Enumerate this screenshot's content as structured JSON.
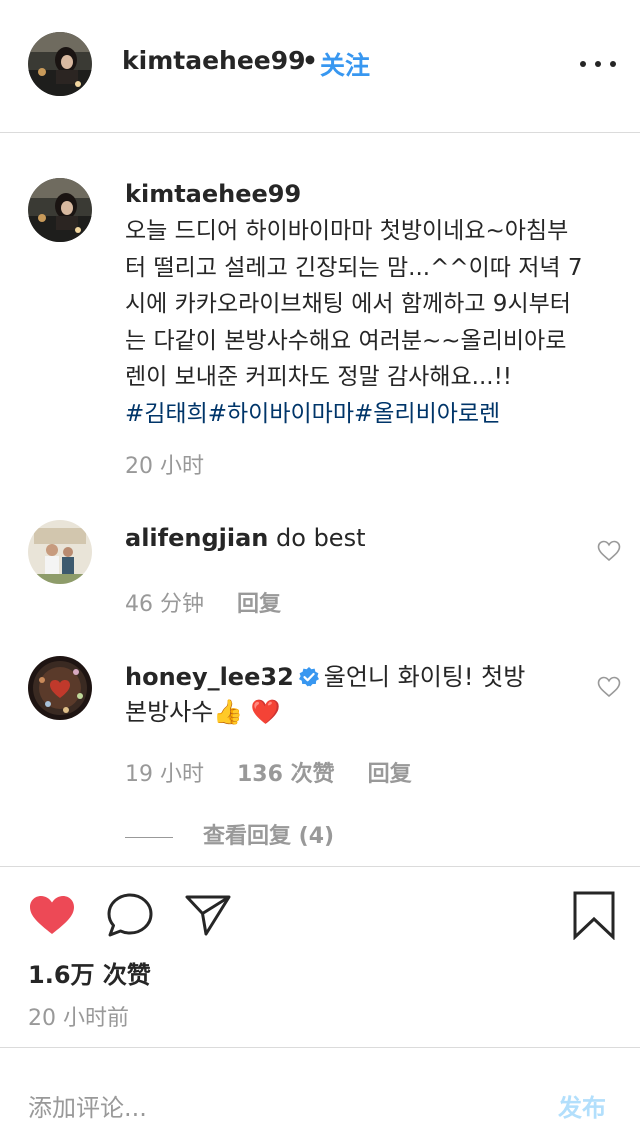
{
  "header": {
    "username": "kimtaehee99",
    "separator": "•",
    "follow_label": "关注"
  },
  "caption": {
    "username": "kimtaehee99",
    "lines": [
      "오늘 드디어 하이바이마마 첫방이네요~아침부",
      "터 떨리고 설레고 긴장되는 맘...^^이따 저녁 7",
      "시에 카카오라이브채팅 에서 함께하고 9시부터",
      "는 다같이 본방사수해요 여러분~~올리비아로",
      "렌이 보내준 커피차도 정말 감사해요...!!"
    ],
    "hashtags": "#김태희#하이바이마마#올리비아로렌",
    "time": "20 小时"
  },
  "comments": [
    {
      "username": "alifengjian",
      "text": "do best",
      "time": "46 分钟",
      "reply_label": "回复"
    },
    {
      "username": "honey_lee32",
      "text_line1": "울언니 화이팅! 첫방",
      "text_line2": "본방사수👍 ❤️",
      "time": "19 小时",
      "likes": "136 次赞",
      "reply_label": "回复",
      "view_replies": "查看回复 (4)"
    }
  ],
  "post": {
    "likes": "1.6万 次赞",
    "time": "20 小时前"
  },
  "composer": {
    "placeholder": "添加评论...",
    "publish_label": "发布"
  },
  "icons": {
    "like": "heart-filled-icon",
    "comment": "comment-bubble-icon",
    "share": "paper-plane-icon",
    "save": "bookmark-icon",
    "more": "more-dots-icon",
    "comment_like": "heart-outline-icon",
    "verified": "verified-badge-icon"
  },
  "colors": {
    "accent": "#3897f0",
    "hashtag": "#003569",
    "like_red": "#ed4956",
    "muted": "#999999",
    "publish_disabled": "#b2dffc"
  }
}
